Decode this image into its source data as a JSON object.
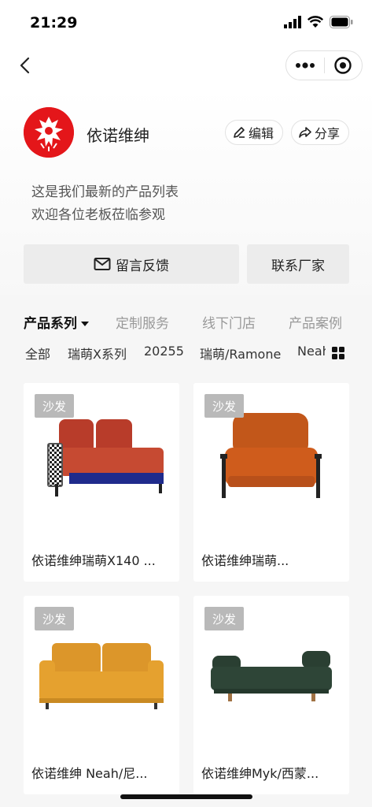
{
  "status_bar": {
    "time": "21:29"
  },
  "nav": {
    "back_icon": "chevron-left-icon",
    "more_icon": "more-dots-icon",
    "close_icon": "target-icon"
  },
  "shop": {
    "name": "依诺维绅",
    "logo_color": "#e4161a",
    "edit_label": "编辑",
    "share_label": "分享",
    "description_line1": "这是我们最新的产品列表",
    "description_line2": "欢迎各位老板莅临参观",
    "message_button": "留言反馈",
    "contact_button": "联系厂家"
  },
  "tabs": [
    {
      "label": "产品系列",
      "active": true
    },
    {
      "label": "定制服务",
      "active": false
    },
    {
      "label": "线下门店",
      "active": false
    },
    {
      "label": "产品案例",
      "active": false
    }
  ],
  "subtabs": [
    {
      "label": "全部"
    },
    {
      "label": "瑞萌X系列"
    },
    {
      "label": "20255"
    },
    {
      "label": "瑞萌/Ramone"
    },
    {
      "label": "Neah"
    }
  ],
  "products": [
    {
      "tag": "沙发",
      "title": "依诺维绅瑞萌X140 ...",
      "seat_color": "#c64a32",
      "base_color": "#1f2b8c"
    },
    {
      "tag": "沙发",
      "title": "依诺维绅瑞萌...",
      "seat_color": "#cf5c1c",
      "base_color": "#cf5c1c"
    },
    {
      "tag": "沙发",
      "title": "依诺维绅 Neah/尼...",
      "seat_color": "#e5a12f",
      "base_color": "#e5a12f"
    },
    {
      "tag": "沙发",
      "title": "依诺维绅Myk/西蒙...",
      "seat_color": "#2e4537",
      "base_color": "#2e4537"
    }
  ]
}
